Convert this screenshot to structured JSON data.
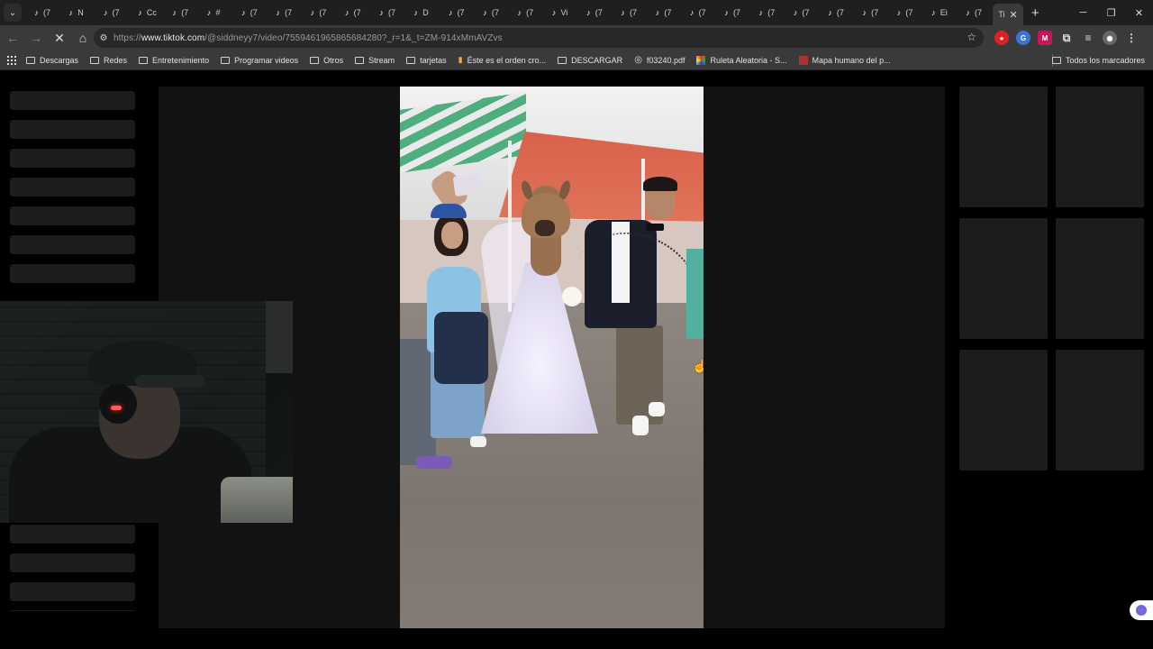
{
  "browser": {
    "tabs": [
      {
        "label": "(7",
        "icon": "tiktok"
      },
      {
        "label": "N",
        "icon": "tiktok"
      },
      {
        "label": "(7",
        "icon": "tiktok"
      },
      {
        "label": "Cc",
        "icon": "tiktok"
      },
      {
        "label": "(7",
        "icon": "tiktok"
      },
      {
        "label": "#",
        "icon": "tiktok"
      },
      {
        "label": "(7",
        "icon": "tiktok"
      },
      {
        "label": "(7",
        "icon": "tiktok"
      },
      {
        "label": "(7",
        "icon": "tiktok"
      },
      {
        "label": "(7",
        "icon": "tiktok"
      },
      {
        "label": "(7",
        "icon": "tiktok"
      },
      {
        "label": "D",
        "icon": "tiktok"
      },
      {
        "label": "(7",
        "icon": "tiktok"
      },
      {
        "label": "(7",
        "icon": "tiktok"
      },
      {
        "label": "(7",
        "icon": "tiktok"
      },
      {
        "label": "Vi",
        "icon": "tiktok"
      },
      {
        "label": "(7",
        "icon": "tiktok"
      },
      {
        "label": "(7",
        "icon": "tiktok"
      },
      {
        "label": "(7",
        "icon": "tiktok"
      },
      {
        "label": "(7",
        "icon": "tiktok"
      },
      {
        "label": "(7",
        "icon": "tiktok"
      },
      {
        "label": "(7",
        "icon": "tiktok"
      },
      {
        "label": "(7",
        "icon": "tiktok"
      },
      {
        "label": "(7",
        "icon": "tiktok"
      },
      {
        "label": "(7",
        "icon": "tiktok"
      },
      {
        "label": "(7",
        "icon": "tiktok"
      },
      {
        "label": "Ei",
        "icon": "tiktok"
      },
      {
        "label": "(7",
        "icon": "tiktok"
      }
    ],
    "active_tab": {
      "label": "Ti"
    },
    "url_prefix": "https://",
    "url_domain": "www.tiktok.com",
    "url_path": "/@siddneyy7/video/7559461965865684280?_r=1&_t=ZM-914xMmAVZvs",
    "bookmarks": [
      {
        "label": "Descargas",
        "icon": "folder-icon"
      },
      {
        "label": "Redes",
        "icon": "folder-icon"
      },
      {
        "label": "Entretenimiento",
        "icon": "folder-icon"
      },
      {
        "label": "Programar videos",
        "icon": "folder-icon"
      },
      {
        "label": "Otros",
        "icon": "folder-icon"
      },
      {
        "label": "Stream",
        "icon": "folder-icon"
      },
      {
        "label": "tarjetas",
        "icon": "folder-icon"
      },
      {
        "label": "Éste es el orden cro...",
        "icon": "page-icon"
      },
      {
        "label": "DESCARGAR",
        "icon": "folder-icon"
      },
      {
        "label": "f03240.pdf",
        "icon": "globe-icon"
      },
      {
        "label": "Ruleta Aleatoria - S...",
        "icon": "wheel-icon"
      },
      {
        "label": "Mapa humano del p...",
        "icon": "map-icon"
      }
    ],
    "all_bookmarks": "Todos los marcadores"
  },
  "colors": {
    "accent_tiktok": "#fe2c55",
    "bg": "#000000",
    "skeleton": "#1c1c1c"
  }
}
